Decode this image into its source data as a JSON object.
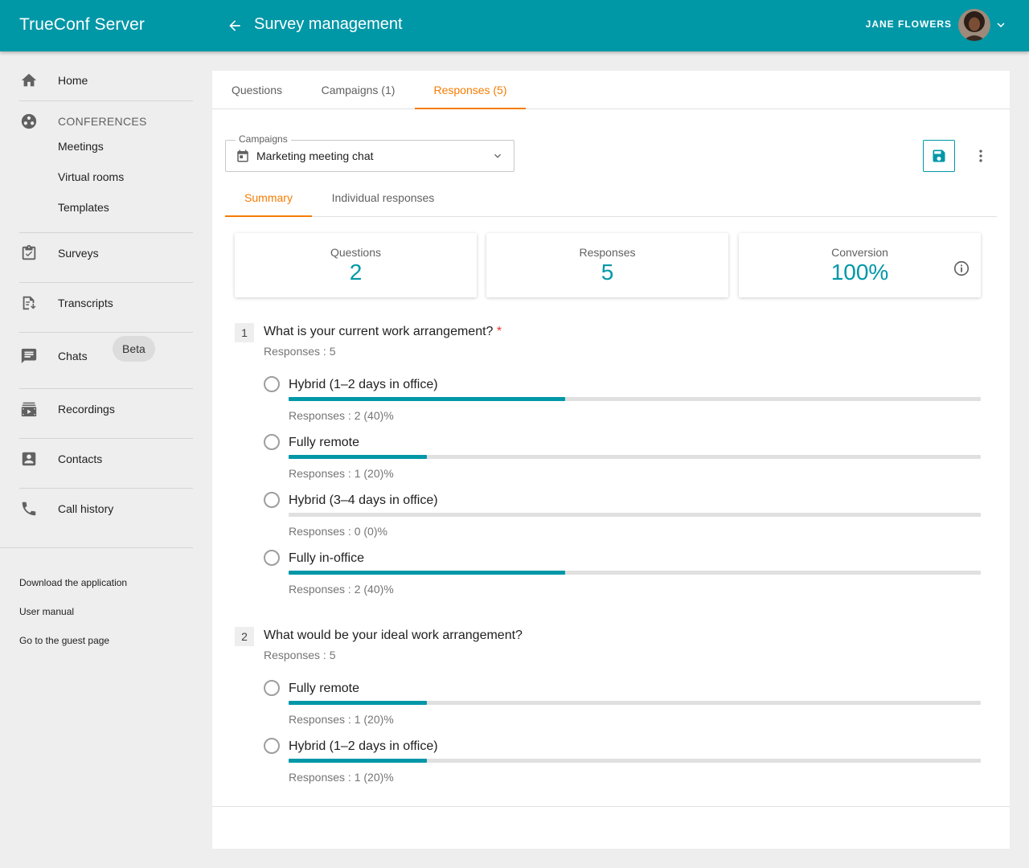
{
  "app": {
    "brand": "TrueConf Server",
    "page_title": "Survey management"
  },
  "user": {
    "name": "JANE FLOWERS"
  },
  "sidebar": {
    "home": "Home",
    "conferences": "CONFERENCES",
    "meetings": "Meetings",
    "virtual_rooms": "Virtual rooms",
    "templates": "Templates",
    "surveys": "Surveys",
    "transcripts": "Transcripts",
    "chats": "Chats",
    "chats_badge": "Beta",
    "recordings": "Recordings",
    "contacts": "Contacts",
    "call_history": "Call history",
    "footer": {
      "download": "Download the application",
      "manual": "User manual",
      "guest": "Go to the guest page"
    }
  },
  "tabs": {
    "questions": "Questions",
    "campaigns": "Campaigns (1)",
    "responses": "Responses (5)",
    "active": "responses"
  },
  "campaign_select": {
    "legend": "Campaigns",
    "value": "Marketing meeting chat"
  },
  "subtabs": {
    "summary": "Summary",
    "individual": "Individual responses",
    "active": "summary"
  },
  "stats": {
    "questions": {
      "label": "Questions",
      "value": "2"
    },
    "responses": {
      "label": "Responses",
      "value": "5"
    },
    "conversion": {
      "label": "Conversion",
      "value": "100%"
    }
  },
  "questions": [
    {
      "number": "1",
      "title": "What is your current work arrangement?",
      "required_mark": "*",
      "responses_text": "Responses : 5",
      "options": [
        {
          "label": "Hybrid (1–2 days in office)",
          "count_text": "Responses : 2 (40)%",
          "fraction": 0.4
        },
        {
          "label": "Fully remote",
          "count_text": "Responses : 1 (20)%",
          "fraction": 0.2
        },
        {
          "label": "Hybrid (3–4 days in office)",
          "count_text": "Responses : 0 (0)%",
          "fraction": 0.0
        },
        {
          "label": "Fully in-office",
          "count_text": "Responses : 2 (40)%",
          "fraction": 0.4
        }
      ]
    },
    {
      "number": "2",
      "title": "What would be your ideal work arrangement?",
      "required_mark": "",
      "responses_text": "Responses : 5",
      "options": [
        {
          "label": "Fully remote",
          "count_text": "Responses : 1 (20)%",
          "fraction": 0.2
        },
        {
          "label": "Hybrid (1–2 days in office)",
          "count_text": "Responses : 1 (20)%",
          "fraction": 0.2
        }
      ]
    }
  ],
  "colors": {
    "primary": "#0097a7",
    "accent": "#f57c00",
    "required": "#e53935"
  }
}
